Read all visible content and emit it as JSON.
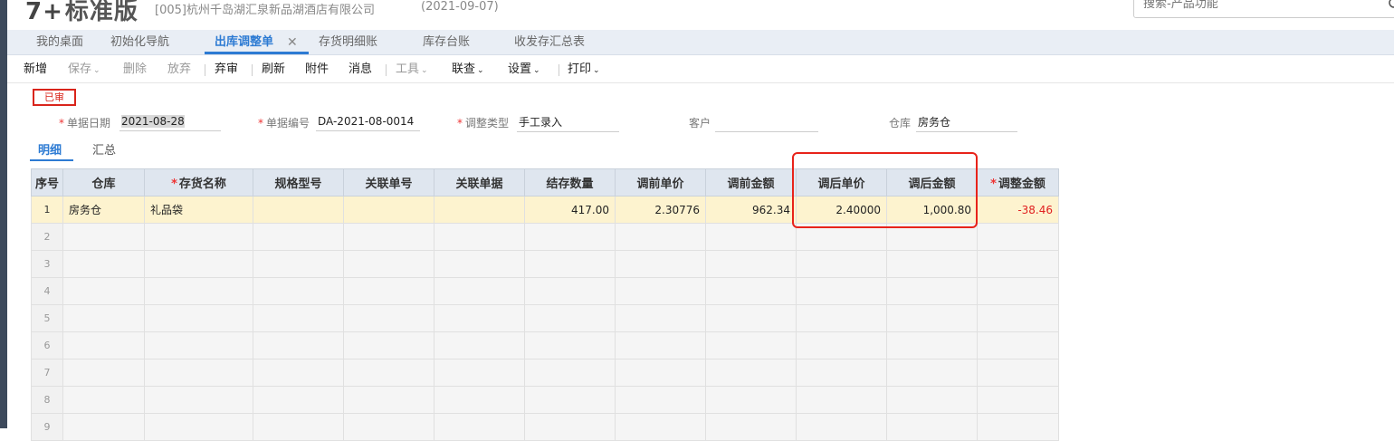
{
  "header": {
    "logo_mark": "7+",
    "logo_text": "标准版",
    "company": "[005]杭州千岛湖汇泉新品湖酒店有限公司",
    "date": "(2021-09-07)",
    "search_placeholder": "搜索-产品功能"
  },
  "tabs": [
    {
      "label": "我的桌面"
    },
    {
      "label": "初始化导航"
    },
    {
      "label": "出库调整单",
      "active": true,
      "close": "✕"
    },
    {
      "label": "存货明细账"
    },
    {
      "label": "库存台账"
    },
    {
      "label": "收发存汇总表"
    }
  ],
  "toolbar": {
    "new": "新增",
    "save": "保存",
    "delete": "删除",
    "discard": "放弃",
    "unaudit": "弃审",
    "refresh": "刷新",
    "attach": "附件",
    "message": "消息",
    "tools": "工具",
    "link": "联查",
    "settings": "设置",
    "print": "打印",
    "caret": "⌄"
  },
  "form": {
    "status": "已审",
    "required_mark": "*",
    "date_label": "单据日期",
    "date_value": "2021-08-28",
    "no_label": "单据编号",
    "no_value": "DA-2021-08-0014",
    "type_label": "调整类型",
    "type_value": "手工录入",
    "customer_label": "客户",
    "customer_value": "",
    "warehouse_label": "仓库",
    "warehouse_value": "房务仓"
  },
  "subtabs": {
    "detail": "明细",
    "summary": "汇总"
  },
  "grid": {
    "columns": [
      "序号",
      "仓库",
      "存货名称",
      "规格型号",
      "关联单号",
      "关联单据",
      "结存数量",
      "调前单价",
      "调前金额",
      "调后单价",
      "调后金额",
      "调整金额"
    ],
    "rows": [
      {
        "idx": "1",
        "warehouse": "房务仓",
        "name": "礼品袋",
        "spec": "",
        "ref_no": "",
        "ref_doc": "",
        "qty": "417.00",
        "pre_price": "2.30776",
        "pre_amount": "962.34",
        "post_price": "2.40000",
        "post_amount": "1,000.80",
        "adjust": "-38.46"
      }
    ],
    "empty_rows": [
      "2",
      "3",
      "4",
      "5",
      "6",
      "7",
      "8",
      "9"
    ]
  },
  "colors": {
    "accent": "#2d7bd3",
    "highlight": "#e8231a",
    "negative": "#e02020",
    "selected_row": "#fdf3cf"
  }
}
